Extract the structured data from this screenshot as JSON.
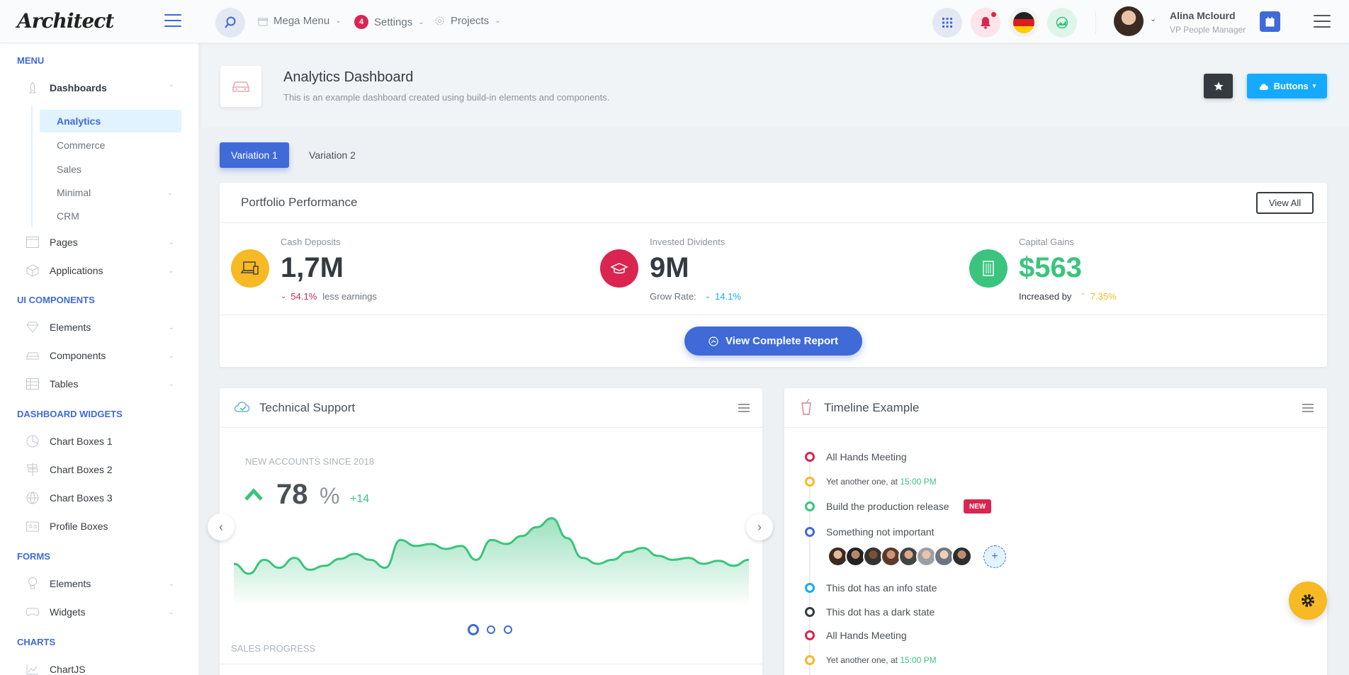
{
  "header": {
    "logo": "Architect",
    "mega_menu": "Mega Menu",
    "settings": "Settings",
    "settings_badge": "4",
    "projects": "Projects",
    "user_name": "Alina Mclourd",
    "user_role": "VP People Manager"
  },
  "sidebar": {
    "sections": [
      "MENU",
      "UI COMPONENTS",
      "DASHBOARD WIDGETS",
      "FORMS",
      "CHARTS"
    ],
    "dashboards": "Dashboards",
    "dashboard_sub": [
      "Analytics",
      "Commerce",
      "Sales",
      "Minimal",
      "CRM"
    ],
    "menu_items": [
      "Pages",
      "Applications"
    ],
    "ui_items": [
      "Elements",
      "Components",
      "Tables"
    ],
    "widget_items": [
      "Chart Boxes 1",
      "Chart Boxes 2",
      "Chart Boxes 3",
      "Profile Boxes"
    ],
    "form_items": [
      "Elements",
      "Widgets"
    ],
    "chart_items": [
      "ChartJS"
    ]
  },
  "page": {
    "title": "Analytics Dashboard",
    "subtitle": "This is an example dashboard created using build-in elements and components.",
    "buttons_label": "Buttons"
  },
  "tabs": [
    "Variation 1",
    "Variation 2"
  ],
  "portfolio": {
    "title": "Portfolio Performance",
    "view_all": "View All",
    "metrics": [
      {
        "label": "Cash Deposits",
        "value": "1,7M",
        "delta": "54.1%",
        "note": "less earnings",
        "color": "#f7b924"
      },
      {
        "label": "Invested Dividents",
        "value": "9M",
        "prefix": "Grow Rate:",
        "delta": "14.1%",
        "color": "#d92550"
      },
      {
        "label": "Capital Gains",
        "value": "$563",
        "prefix": "Increased by",
        "delta": "7.35%",
        "color": "#3ac47d"
      }
    ],
    "report_button": "View Complete Report"
  },
  "support": {
    "title": "Technical Support",
    "label": "NEW ACCOUNTS SINCE 2018",
    "value": "78",
    "unit": "%",
    "change": "+14",
    "footer": "SALES PROGRESS"
  },
  "chart_data": {
    "type": "area",
    "color": "#3ac47d",
    "values": [
      40,
      30,
      44,
      36,
      46,
      34,
      38,
      45,
      50,
      44,
      36,
      64,
      58,
      60,
      55,
      58,
      44,
      64,
      60,
      68,
      77,
      86,
      66,
      46,
      40,
      44,
      52,
      56,
      48,
      44,
      46,
      40,
      43,
      38,
      44
    ]
  },
  "timeline": {
    "title": "Timeline Example",
    "items": [
      {
        "text": "All Hands Meeting",
        "color": "#d92550"
      },
      {
        "text": "Yet another one, at ",
        "time": "15:00 PM",
        "color": "#f7b924"
      },
      {
        "text": "Build the production release",
        "badge": "NEW",
        "color": "#3ac47d"
      },
      {
        "text": "Something not important",
        "color": "#3f6ad8"
      },
      {
        "text": "This dot has an info state",
        "color": "#16aaff"
      },
      {
        "text": "This dot has a dark state",
        "color": "#343a40"
      },
      {
        "text": "All Hands Meeting",
        "color": "#d92550"
      },
      {
        "text": "Yet another one, at ",
        "time": "15:00 PM",
        "color": "#f7b924"
      }
    ],
    "add_label": "+"
  }
}
